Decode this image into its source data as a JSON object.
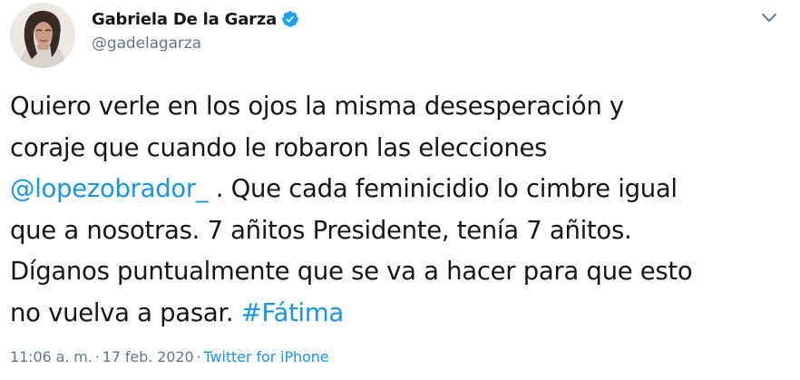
{
  "author": {
    "display_name": "Gabriela De la Garza",
    "handle": "@gadelagarza",
    "verified": true,
    "avatar_icon": "profile-photo"
  },
  "tweet": {
    "lines": [
      {
        "parts": [
          {
            "text": "Quiero verle en los ojos la misma desesperación y",
            "type": "text"
          }
        ]
      },
      {
        "parts": [
          {
            "text": "coraje que cuando le robaron las elecciones",
            "type": "text"
          }
        ]
      },
      {
        "parts": [
          {
            "text": "@lopezobrador_",
            "type": "mention"
          },
          {
            "text": " . Que cada feminicidio lo cimbre igual",
            "type": "text"
          }
        ]
      },
      {
        "parts": [
          {
            "text": "que a nosotras. 7 añitos Presidente, tenía 7 añitos.",
            "type": "text"
          }
        ]
      },
      {
        "parts": [
          {
            "text": "Díganos puntualmente que se va a hacer para que esto",
            "type": "text"
          }
        ]
      },
      {
        "parts": [
          {
            "text": "no vuelva a pasar. ",
            "type": "text"
          },
          {
            "text": "#Fátima",
            "type": "hashtag"
          }
        ]
      }
    ]
  },
  "meta": {
    "time": "11:06 a. m.",
    "separator": "·",
    "date": "17 feb. 2020",
    "source": "Twitter for iPhone"
  },
  "colors": {
    "link": "#1b95e0",
    "secondary_text": "#657786",
    "primary_text": "#14171a",
    "verified_badge": "#1da1f2"
  },
  "icons": {
    "verified": "verified-badge-icon",
    "menu": "chevron-down-icon"
  }
}
